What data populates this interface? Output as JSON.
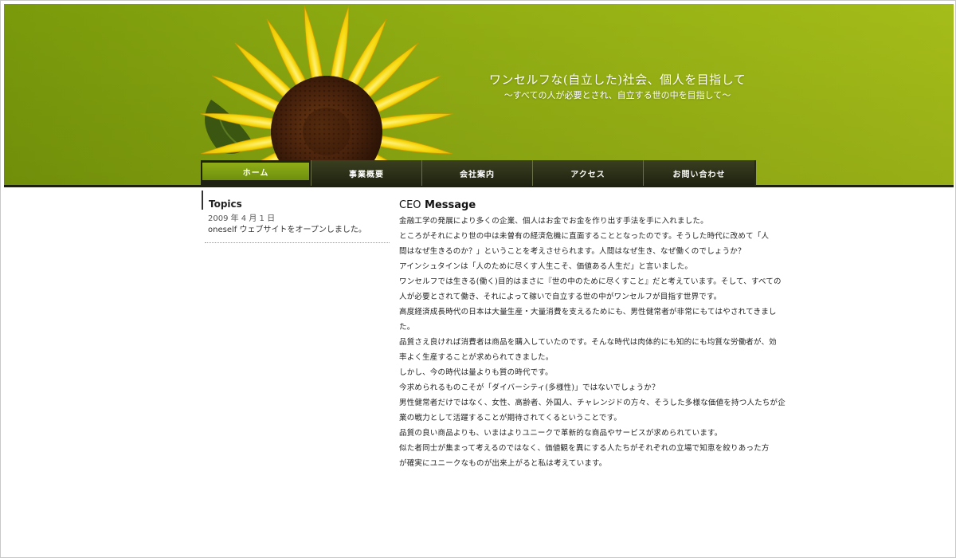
{
  "header": {
    "tagline_main": "ワンセルフな(自立した)社会、個人を目指して",
    "tagline_sub": "〜すべての人が必要とされ、自立する世の中を目指して〜"
  },
  "nav": {
    "items": [
      {
        "label": "ホーム",
        "active": true
      },
      {
        "label": "事業概要",
        "active": false
      },
      {
        "label": "会社案内",
        "active": false
      },
      {
        "label": "アクセス",
        "active": false
      },
      {
        "label": "お問い合わせ",
        "active": false
      }
    ]
  },
  "topics": {
    "heading": "Topics",
    "date": "2009 年 4 月 1 日",
    "text": "oneself ウェブサイトをオープンしました。"
  },
  "ceo": {
    "title_prefix": "CEO",
    "title_rest": " Message",
    "lines": [
      "金融工学の発展により多くの企業、個人はお金でお金を作り出す手法を手に入れました。",
      "ところがそれにより世の中は未曽有の経済危機に直面することとなったのです。そうした時代に改めて「人",
      "間はなぜ生きるのか？」ということを考えさせられます。人間はなぜ生き、なぜ働くのでしょうか？",
      "アインシュタインは「人のために尽くす人生こそ、価値ある人生だ」と言いました。",
      "ワンセルフでは生きる(働く)目的はまさに『世の中のために尽くすこと』だと考えています。そして、すべての",
      "人が必要とされて働き、それによって稼いで自立する世の中がワンセルフが目指す世界です。",
      "高度経済成長時代の日本は大量生産・大量消費を支えるためにも、男性健常者が非常にもてはやされてきまし",
      "た。",
      "品質さえ良ければ消費者は商品を購入していたのです。そんな時代は肉体的にも知的にも均質な労働者が、効",
      "率よく生産することが求められてきました。",
      "しかし、今の時代は量よりも質の時代です。",
      "今求められるものこそが「ダイバーシティ(多様性)」ではないでしょうか？",
      "男性健常者だけではなく、女性、高齢者、外国人、チャレンジドの方々、そうした多様な価値を持つ人たちが企",
      "業の戦力として活躍することが期待されてくるということです。",
      "品質の良い商品よりも、いまはよりユニークで革新的な商品やサービスが求められています。",
      "似た者同士が集まって考えるのではなく、価値観を異にする人たちがそれぞれの立場で知恵を絞りあった方",
      "が確実にユニークなものが出来上がると私は考えています。"
    ]
  },
  "colors": {
    "header_green": "#90ad12",
    "nav_dark": "#272b14",
    "nav_active": "#7a9a10",
    "petal_yellow": "#f5d90a",
    "flower_center": "#4a2410"
  }
}
